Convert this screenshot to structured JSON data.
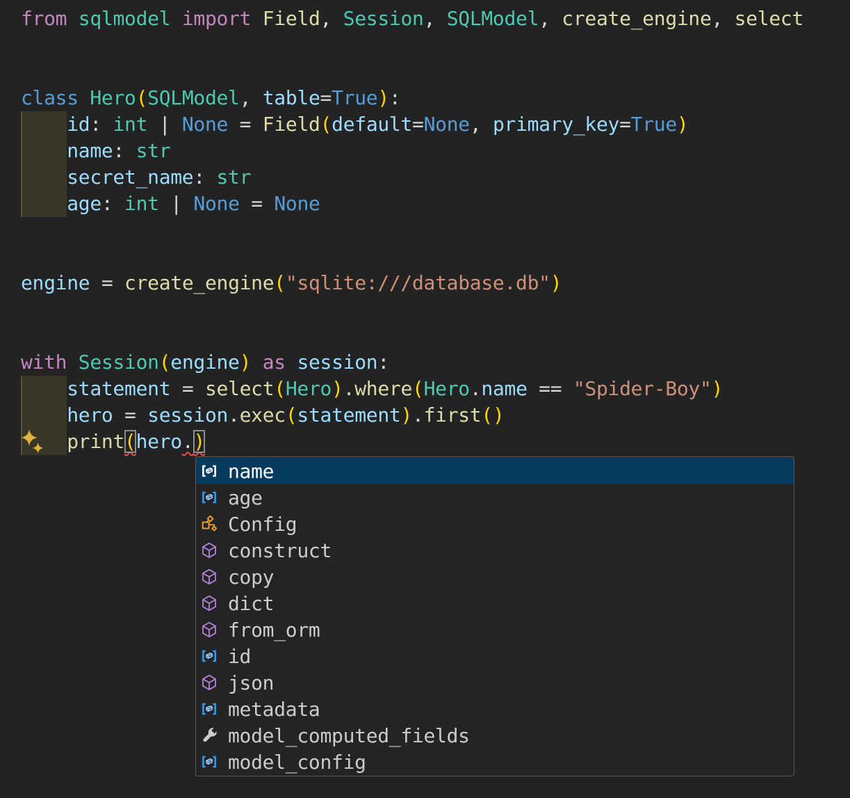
{
  "app": {
    "kind": "code-editor",
    "language": "python"
  },
  "colors": {
    "editor_background": "#232323",
    "keyword_pink": "#C586C0",
    "keyword_blue": "#569CD6",
    "type_teal": "#4EC9B0",
    "function_yellow": "#DCDCAA",
    "variable_blue": "#9CDCFE",
    "string_salmon": "#CE9178",
    "bracket_gold": "#FFD700",
    "punctuation": "#d6d6d6",
    "error_squiggle": "#f14c4c",
    "bracket_match_border": "#8d8d8d",
    "indent_highlight": "#383627",
    "sparkle_gold": "#e3b23c",
    "suggest_background": "#242425",
    "suggest_border": "#5a5a5a",
    "suggest_selected_background": "#063b5e",
    "suggest_label": "#cccccc",
    "icon_field_blue": "#2b9af3",
    "icon_class_orange": "#ee9d28",
    "icon_method_purple": "#b180d7",
    "icon_property_gray": "#cfcfcf"
  },
  "editor": {
    "lines": [
      {
        "line": 1,
        "segments": [
          [
            "kw",
            "from"
          ],
          [
            "p",
            " "
          ],
          [
            "ty",
            "sqlmodel"
          ],
          [
            "p",
            " "
          ],
          [
            "kw",
            "import"
          ],
          [
            "p",
            " "
          ],
          [
            "fn",
            "Field"
          ],
          [
            "p",
            ", "
          ],
          [
            "ty",
            "Session"
          ],
          [
            "p",
            ", "
          ],
          [
            "ty",
            "SQLModel"
          ],
          [
            "p",
            ", "
          ],
          [
            "fn",
            "create_engine"
          ],
          [
            "p",
            ", "
          ],
          [
            "fn",
            "select"
          ]
        ]
      },
      {
        "line": 4,
        "segments": [
          [
            "kwb",
            "class"
          ],
          [
            "p",
            " "
          ],
          [
            "ty",
            "Hero"
          ],
          [
            "br",
            "("
          ],
          [
            "ty",
            "SQLModel"
          ],
          [
            "p",
            ", "
          ],
          [
            "v",
            "table"
          ],
          [
            "p",
            "="
          ],
          [
            "kwb",
            "True"
          ],
          [
            "br",
            ")"
          ],
          [
            "p",
            ":"
          ]
        ]
      },
      {
        "line": 5,
        "segments": [
          [
            "p",
            "    "
          ],
          [
            "v",
            "id"
          ],
          [
            "p",
            ": "
          ],
          [
            "ty",
            "int"
          ],
          [
            "p",
            " | "
          ],
          [
            "kwb",
            "None"
          ],
          [
            "p",
            " = "
          ],
          [
            "fn",
            "Field"
          ],
          [
            "br",
            "("
          ],
          [
            "v",
            "default"
          ],
          [
            "p",
            "="
          ],
          [
            "kwb",
            "None"
          ],
          [
            "p",
            ", "
          ],
          [
            "v",
            "primary_key"
          ],
          [
            "p",
            "="
          ],
          [
            "kwb",
            "True"
          ],
          [
            "br",
            ")"
          ]
        ]
      },
      {
        "line": 6,
        "segments": [
          [
            "p",
            "    "
          ],
          [
            "v",
            "name"
          ],
          [
            "p",
            ": "
          ],
          [
            "ty",
            "str"
          ]
        ]
      },
      {
        "line": 7,
        "segments": [
          [
            "p",
            "    "
          ],
          [
            "v",
            "secret_name"
          ],
          [
            "p",
            ": "
          ],
          [
            "ty",
            "str"
          ]
        ]
      },
      {
        "line": 8,
        "segments": [
          [
            "p",
            "    "
          ],
          [
            "v",
            "age"
          ],
          [
            "p",
            ": "
          ],
          [
            "ty",
            "int"
          ],
          [
            "p",
            " | "
          ],
          [
            "kwb",
            "None"
          ],
          [
            "p",
            " = "
          ],
          [
            "kwb",
            "None"
          ]
        ]
      },
      {
        "line": 11,
        "segments": [
          [
            "v",
            "engine"
          ],
          [
            "p",
            " = "
          ],
          [
            "fn",
            "create_engine"
          ],
          [
            "br",
            "("
          ],
          [
            "st",
            "\"sqlite:///database.db\""
          ],
          [
            "br",
            ")"
          ]
        ]
      },
      {
        "line": 14,
        "segments": [
          [
            "kw",
            "with"
          ],
          [
            "p",
            " "
          ],
          [
            "ty",
            "Session"
          ],
          [
            "br",
            "("
          ],
          [
            "v",
            "engine"
          ],
          [
            "br",
            ")"
          ],
          [
            "p",
            " "
          ],
          [
            "kw",
            "as"
          ],
          [
            "p",
            " "
          ],
          [
            "v",
            "session"
          ],
          [
            "p",
            ":"
          ]
        ]
      },
      {
        "line": 15,
        "segments": [
          [
            "p",
            "    "
          ],
          [
            "v",
            "statement"
          ],
          [
            "p",
            " = "
          ],
          [
            "fn",
            "select"
          ],
          [
            "br",
            "("
          ],
          [
            "ty",
            "Hero"
          ],
          [
            "br",
            ")"
          ],
          [
            "p",
            "."
          ],
          [
            "fn",
            "where"
          ],
          [
            "br",
            "("
          ],
          [
            "ty",
            "Hero"
          ],
          [
            "p",
            "."
          ],
          [
            "v",
            "name"
          ],
          [
            "p",
            " == "
          ],
          [
            "st",
            "\"Spider-Boy\""
          ],
          [
            "br",
            ")"
          ]
        ]
      },
      {
        "line": 16,
        "segments": [
          [
            "p",
            "    "
          ],
          [
            "v",
            "hero"
          ],
          [
            "p",
            " = "
          ],
          [
            "v",
            "session"
          ],
          [
            "p",
            "."
          ],
          [
            "fn",
            "exec"
          ],
          [
            "br",
            "("
          ],
          [
            "v",
            "statement"
          ],
          [
            "br",
            ")"
          ],
          [
            "p",
            "."
          ],
          [
            "fn",
            "first"
          ],
          [
            "br",
            "("
          ],
          [
            "br",
            ")"
          ]
        ]
      },
      {
        "line": 17,
        "segments": [
          [
            "p",
            "    "
          ],
          [
            "fn",
            "print"
          ],
          [
            "br m sq",
            "("
          ],
          [
            "v",
            "hero"
          ],
          [
            "p sq",
            "."
          ],
          [
            "br m sq",
            ")"
          ]
        ]
      }
    ],
    "indent_highlights": [
      {
        "from_line": 5,
        "to_line": 8
      },
      {
        "from_line": 15,
        "to_line": 17
      }
    ],
    "sparkle_action_line": 17
  },
  "suggest": {
    "items": [
      {
        "label": "name",
        "kind": "field",
        "selected": true
      },
      {
        "label": "age",
        "kind": "field",
        "selected": false
      },
      {
        "label": "Config",
        "kind": "class",
        "selected": false
      },
      {
        "label": "construct",
        "kind": "method",
        "selected": false
      },
      {
        "label": "copy",
        "kind": "method",
        "selected": false
      },
      {
        "label": "dict",
        "kind": "method",
        "selected": false
      },
      {
        "label": "from_orm",
        "kind": "method",
        "selected": false
      },
      {
        "label": "id",
        "kind": "field",
        "selected": false
      },
      {
        "label": "json",
        "kind": "method",
        "selected": false
      },
      {
        "label": "metadata",
        "kind": "field",
        "selected": false
      },
      {
        "label": "model_computed_fields",
        "kind": "property",
        "selected": false
      },
      {
        "label": "model_config",
        "kind": "field",
        "selected": false
      }
    ],
    "icon_names": {
      "field": "symbol-field-icon",
      "class": "symbol-class-icon",
      "method": "symbol-method-icon",
      "property": "symbol-property-icon"
    }
  }
}
